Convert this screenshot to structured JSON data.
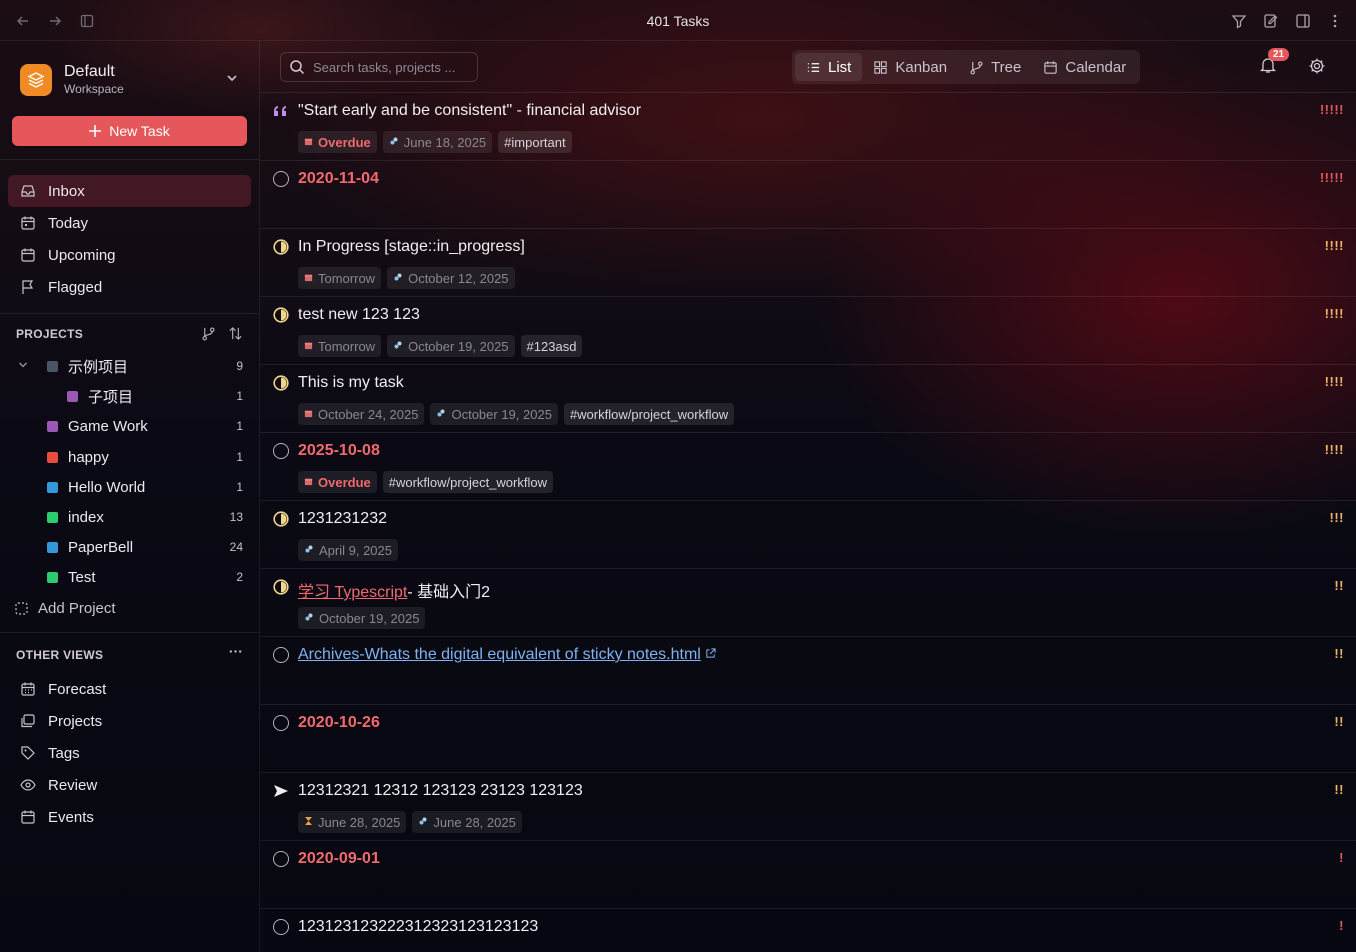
{
  "window": {
    "title": "401 Tasks"
  },
  "workspace": {
    "name": "Default",
    "subtitle": "Workspace"
  },
  "sidebar": {
    "new_task_label": "New Task",
    "nav": [
      {
        "label": "Inbox",
        "icon": "inbox-icon",
        "active": true
      },
      {
        "label": "Today",
        "icon": "calendar-today-icon"
      },
      {
        "label": "Upcoming",
        "icon": "calendar-upcoming-icon"
      },
      {
        "label": "Flagged",
        "icon": "flag-icon"
      }
    ],
    "projects_heading": "PROJECTS",
    "projects": [
      {
        "name": "示例项目",
        "count": "9",
        "color": "#4a5568",
        "expanded": true
      },
      {
        "name": "子项目",
        "count": "1",
        "color": "#9b59b6",
        "child": true
      },
      {
        "name": "Game Work",
        "count": "1",
        "color": "#9b59b6"
      },
      {
        "name": "happy",
        "count": "1",
        "color": "#e74c3c"
      },
      {
        "name": "Hello World",
        "count": "1",
        "color": "#3498db"
      },
      {
        "name": "index",
        "count": "13",
        "color": "#2ecc71"
      },
      {
        "name": "PaperBell",
        "count": "24",
        "color": "#3498db"
      },
      {
        "name": "Test",
        "count": "2",
        "color": "#2ecc71"
      }
    ],
    "add_project_label": "Add Project",
    "other_views_heading": "OTHER VIEWS",
    "other_views": [
      {
        "label": "Forecast",
        "icon": "forecast-icon"
      },
      {
        "label": "Projects",
        "icon": "projects-icon"
      },
      {
        "label": "Tags",
        "icon": "tag-icon"
      },
      {
        "label": "Review",
        "icon": "eye-icon"
      },
      {
        "label": "Events",
        "icon": "events-icon"
      }
    ]
  },
  "toolbar": {
    "search_placeholder": "Search tasks, projects ...",
    "views": [
      "List",
      "Kanban",
      "Tree",
      "Calendar"
    ],
    "active_view": "List",
    "notification_count": "21"
  },
  "colors": {
    "accent": "#e5575b",
    "overdue": "#f06a6d",
    "priority_high": "#e5575b",
    "priority_med": "#f0b36b"
  },
  "tasks": [
    {
      "status": "quote",
      "title": "\"Start early and be consistent\" - financial advisor",
      "priority": "!!!!!",
      "tags": [
        {
          "type": "overdue",
          "text": "Overdue"
        },
        {
          "type": "date",
          "text": "June 18, 2025"
        },
        {
          "type": "hashtag",
          "text": "#important"
        }
      ]
    },
    {
      "status": "open",
      "title": "2020-11-04",
      "title_style": "date",
      "priority": "!!!!!",
      "tags": []
    },
    {
      "status": "progress",
      "title": "In Progress [stage::in_progress]",
      "priority": "!!!!",
      "tags": [
        {
          "type": "date",
          "text": "Tomorrow"
        },
        {
          "type": "date",
          "text": "October 12, 2025"
        }
      ]
    },
    {
      "status": "progress",
      "title": "test new 123 123",
      "priority": "!!!!",
      "tags": [
        {
          "type": "date",
          "text": "Tomorrow"
        },
        {
          "type": "date",
          "text": "October 19, 2025"
        },
        {
          "type": "hashtag",
          "text": "#123asd"
        }
      ]
    },
    {
      "status": "progress",
      "title": "This is my task",
      "priority": "!!!!",
      "tags": [
        {
          "type": "date",
          "text": "October 24, 2025"
        },
        {
          "type": "date",
          "text": "October 19, 2025"
        },
        {
          "type": "hashtag",
          "text": "#workflow/project_workflow"
        }
      ]
    },
    {
      "status": "open",
      "title": "2025-10-08",
      "title_style": "date",
      "priority": "!!!!",
      "tags": [
        {
          "type": "overdue",
          "text": "Overdue"
        },
        {
          "type": "hashtag",
          "text": "#workflow/project_workflow"
        }
      ]
    },
    {
      "status": "progress",
      "title": "1231231232",
      "priority": "!!!",
      "tags": [
        {
          "type": "date",
          "text": "April 9, 2025"
        }
      ]
    },
    {
      "status": "progress",
      "title_link": "学习 Typescript",
      "title_rest": "- 基础入门2",
      "priority": "!!",
      "tags": [
        {
          "type": "date",
          "text": "October 19, 2025"
        }
      ]
    },
    {
      "status": "open",
      "title_extlink": "Archives-Whats the digital equivalent of sticky notes.html",
      "priority": "!!",
      "tags": []
    },
    {
      "status": "open",
      "title": "2020-10-26",
      "title_style": "date",
      "priority": "!!",
      "tags": []
    },
    {
      "status": "forwarded",
      "title": "12312321 12312 123123 23123 123123",
      "priority": "!!",
      "tags": [
        {
          "type": "date",
          "text": "June 28, 2025"
        },
        {
          "type": "date",
          "text": "June 28, 2025"
        }
      ]
    },
    {
      "status": "open",
      "title": "2020-09-01",
      "title_style": "date",
      "priority": "!",
      "tags": []
    },
    {
      "status": "open",
      "title": "12312312322231232312312312 3",
      "title_display": "1231231232223123231231231 23",
      "priority": "!",
      "tags": []
    }
  ]
}
